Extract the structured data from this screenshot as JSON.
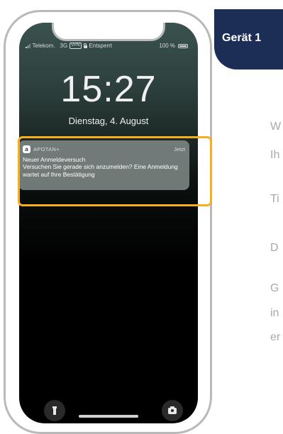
{
  "status_bar": {
    "carrier": "Telekom.",
    "network": "3G",
    "vpn": "VPN",
    "lock_status": "Entsperrt",
    "battery": "100 %"
  },
  "lock_screen": {
    "time": "15:27",
    "date": "Dienstag, 4. August"
  },
  "notification": {
    "app_icon_letter": "a",
    "app_name": "APOTAN+",
    "time": "Jetzt",
    "title": "Neuer Anmeldeversuch",
    "body": "Versuchen Sie gerade sich anzumelden? Eine Anmeldung wartet auf Ihre Bestätigung"
  },
  "device_label": "Gerät 1",
  "side_text": [
    "W",
    "Ih",
    "Ti",
    "D",
    "G",
    "in",
    "er"
  ],
  "colors": {
    "navy": "#1d2e56",
    "highlight": "#f6ae1f",
    "phone_frame": "#b9b9b9",
    "side_text": "#a9a9a9"
  },
  "icons": [
    "signal-icon",
    "vpn-icon",
    "lock-icon",
    "battery-icon",
    "flashlight-icon",
    "camera-icon"
  ]
}
